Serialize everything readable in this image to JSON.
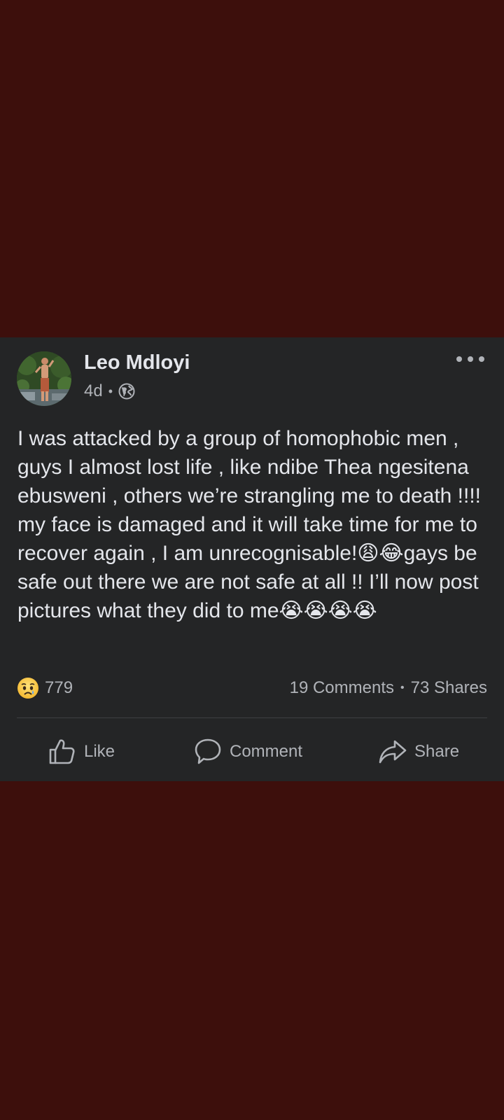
{
  "post": {
    "author": "Leo Mdloyi",
    "time": "4d",
    "separator": "•",
    "text": "I was attacked by a group of homophobic men , guys I almost lost life , like ndibe Thea ngesitena ebusweni , others we’re strangling me to death !!!! my face is damaged and it will take time for me to recover again , I am unrecognisable!😩😂gays be safe out there we are not safe at all !! I’ll now post pictures what they did to me😭😭😭😭",
    "privacy_icon": "globe-icon",
    "more_icon": "more-options-icon"
  },
  "stats": {
    "reaction_icon": "sad-reaction-icon",
    "reaction_count": "779",
    "comments": "19 Comments",
    "separator": "•",
    "shares": "73 Shares"
  },
  "actions": {
    "like_label": "Like",
    "comment_label": "Comment",
    "share_label": "Share"
  },
  "colors": {
    "background": "#3d0f0c",
    "card": "#242526",
    "primary_text": "#e4e6eb",
    "secondary_text": "#b0b3b8",
    "divider": "#3e4042"
  }
}
